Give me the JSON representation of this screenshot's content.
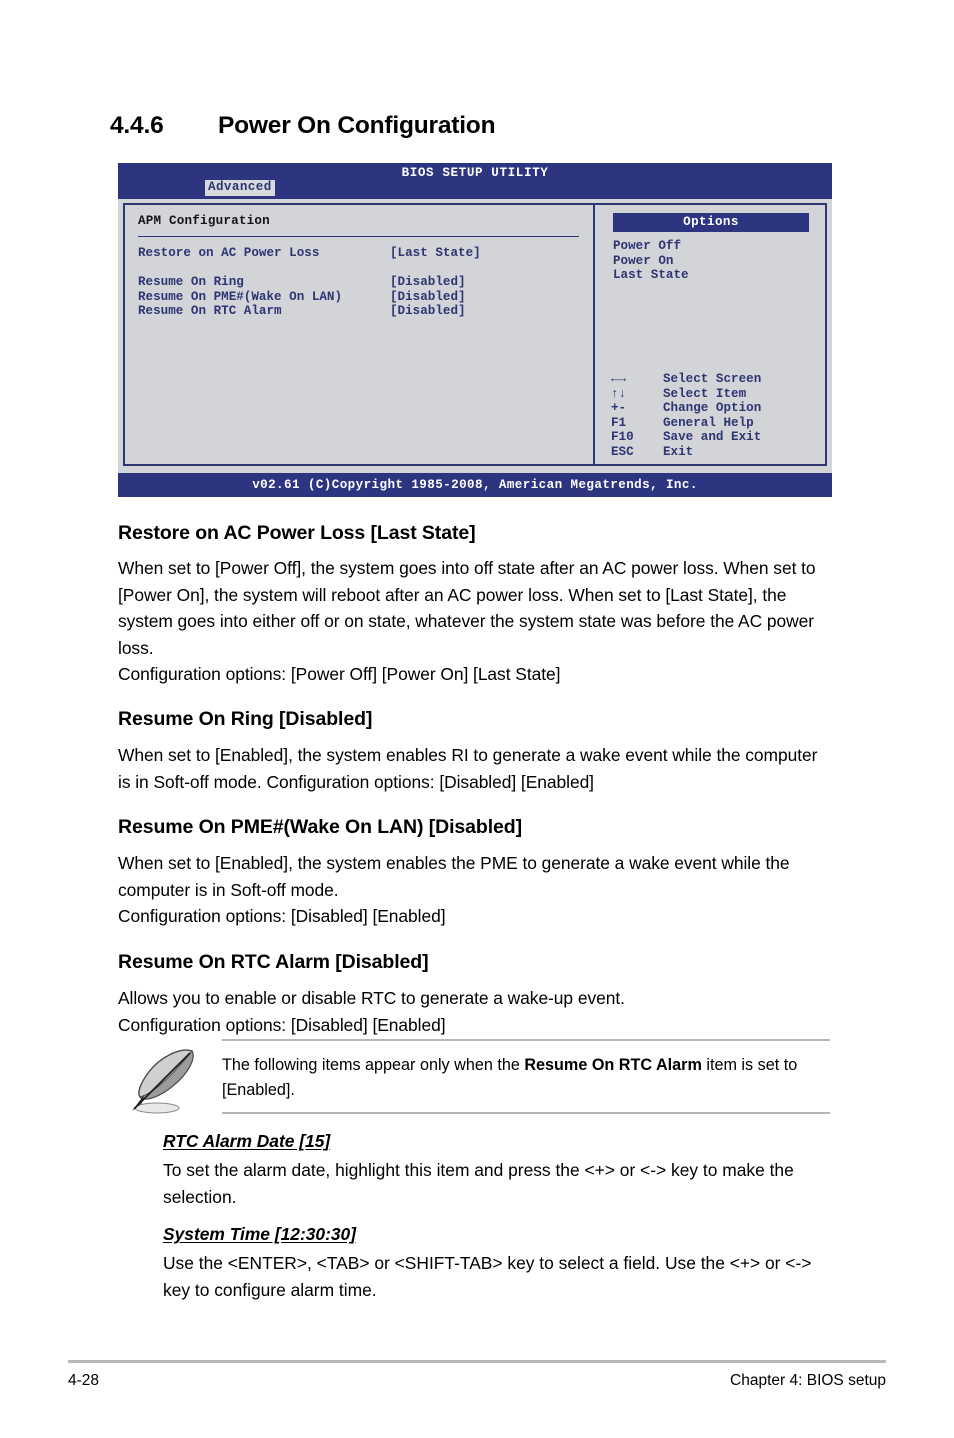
{
  "section": {
    "number": "4.4.6",
    "title": "Power On Configuration"
  },
  "bios": {
    "title": "BIOS SETUP UTILITY",
    "tab": "Advanced",
    "panel_title": "APM Configuration",
    "settings": [
      {
        "label": "Restore on AC Power Loss",
        "value": "[Last State]"
      },
      {
        "label": "Resume On Ring",
        "value": "[Disabled]"
      },
      {
        "label": "Resume On PME#(Wake On LAN)",
        "value": "[Disabled]"
      },
      {
        "label": "Resume On RTC Alarm",
        "value": "[Disabled]"
      }
    ],
    "options_header": "Options",
    "options": [
      "Power Off",
      "Power On",
      "Last State"
    ],
    "keys": [
      {
        "key": "←→",
        "desc": "Select Screen"
      },
      {
        "key": "↑↓",
        "desc": "Select Item"
      },
      {
        "key": "+-",
        "desc": "Change Option"
      },
      {
        "key": "F1",
        "desc": "General Help"
      },
      {
        "key": "F10",
        "desc": "Save and Exit"
      },
      {
        "key": "ESC",
        "desc": "Exit"
      }
    ],
    "footer": "v02.61 (C)Copyright 1985-2008, American Megatrends, Inc.",
    "colors": {
      "header_blue": "#2d3580",
      "panel_gray": "#d2d4d8",
      "text_blue": "#2e3573"
    }
  },
  "items": {
    "restore": {
      "heading": "Restore on AC Power Loss [Last State]",
      "body": "When set to [Power Off], the system goes into off state after an AC power loss. When set to [Power On], the system will reboot after an AC power loss. When set to [Last State], the system goes into either off or on state, whatever the system state was before the AC power loss.",
      "options_line": "Configuration options: [Power Off] [Power On] [Last State]"
    },
    "ring": {
      "heading": "Resume On Ring [Disabled]",
      "body": "When set to [Enabled], the system enables RI to generate a wake event while the computer is in Soft-off mode. Configuration options: [Disabled] [Enabled]"
    },
    "pme": {
      "heading": "Resume On PME#(Wake On LAN) [Disabled]",
      "body": "When set to [Enabled], the system enables the PME to generate a wake event while the computer is in Soft-off mode.",
      "options_line": "Configuration options: [Disabled] [Enabled]"
    },
    "rtc": {
      "heading": "Resume On RTC Alarm [Disabled]",
      "body": "Allows you to enable or disable RTC to generate a wake-up event.",
      "options_line": "Configuration options: [Disabled] [Enabled]"
    }
  },
  "note": {
    "text_before": "The following items appear only when the ",
    "text_bold": "Resume On RTC Alarm",
    "text_after": " item is set to [Enabled]."
  },
  "sub_items": [
    {
      "title": "RTC Alarm Date [15]",
      "body": "To set the alarm date, highlight this item and press the <+> or <-> key to make the selection."
    },
    {
      "title": "System Time [12:30:30]",
      "body": "Use the <ENTER>, <TAB> or <SHIFT-TAB> key to select a field. Use the <+> or <-> key to configure alarm time."
    }
  ],
  "footer": {
    "page_number": "4-28",
    "chapter": "Chapter 4: BIOS setup"
  }
}
